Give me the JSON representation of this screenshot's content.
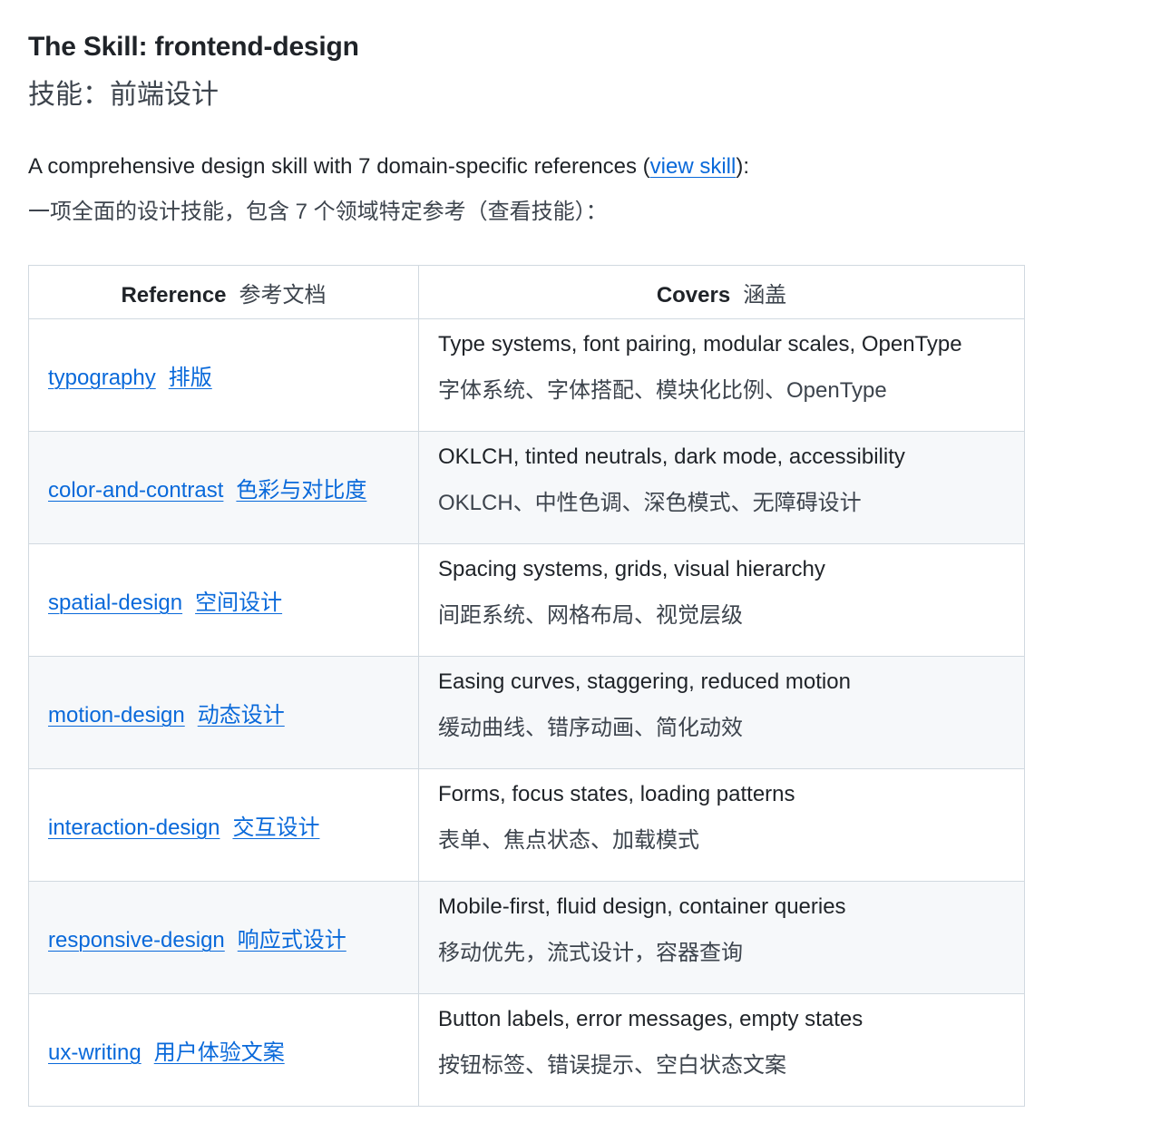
{
  "heading": {
    "title": "The Skill: frontend-design",
    "subtitle": "技能：前端设计"
  },
  "intro": {
    "before_link": "A comprehensive design skill with 7 domain-specific references (",
    "link_text": "view skill",
    "after_link": "):",
    "zh": "一项全面的设计技能，包含 7 个领域特定参考（查看技能）："
  },
  "table": {
    "headers": {
      "reference": "Reference",
      "reference_zh": "参考文档",
      "covers": "Covers",
      "covers_zh": "涵盖"
    },
    "rows": [
      {
        "ref": "typography",
        "ref_zh": "排版",
        "covers_en": "Type systems, font pairing, modular scales, OpenType",
        "covers_zh": "字体系统、字体搭配、模块化比例、OpenType"
      },
      {
        "ref": "color-and-contrast",
        "ref_zh": "色彩与对比度",
        "covers_en": "OKLCH, tinted neutrals, dark mode, accessibility",
        "covers_zh": "OKLCH、中性色调、深色模式、无障碍设计"
      },
      {
        "ref": "spatial-design",
        "ref_zh": "空间设计",
        "covers_en": "Spacing systems, grids, visual hierarchy",
        "covers_zh": "间距系统、网格布局、视觉层级"
      },
      {
        "ref": "motion-design",
        "ref_zh": "动态设计",
        "covers_en": "Easing curves, staggering, reduced motion",
        "covers_zh": "缓动曲线、错序动画、简化动效"
      },
      {
        "ref": "interaction-design",
        "ref_zh": "交互设计",
        "covers_en": "Forms, focus states, loading patterns",
        "covers_zh": "表单、焦点状态、加载模式"
      },
      {
        "ref": "responsive-design",
        "ref_zh": "响应式设计",
        "covers_en": "Mobile-first, fluid design, container queries",
        "covers_zh": "移动优先，流式设计，容器查询"
      },
      {
        "ref": "ux-writing",
        "ref_zh": "用户体验文案",
        "covers_en": "Button labels, error messages, empty states",
        "covers_zh": "按钮标签、错误提示、空白状态文案"
      }
    ]
  },
  "colors": {
    "link": "#0969da",
    "text": "#1f2328",
    "muted_text": "#3d444d",
    "border": "#d1d9e0",
    "stripe": "#f6f8fa"
  }
}
